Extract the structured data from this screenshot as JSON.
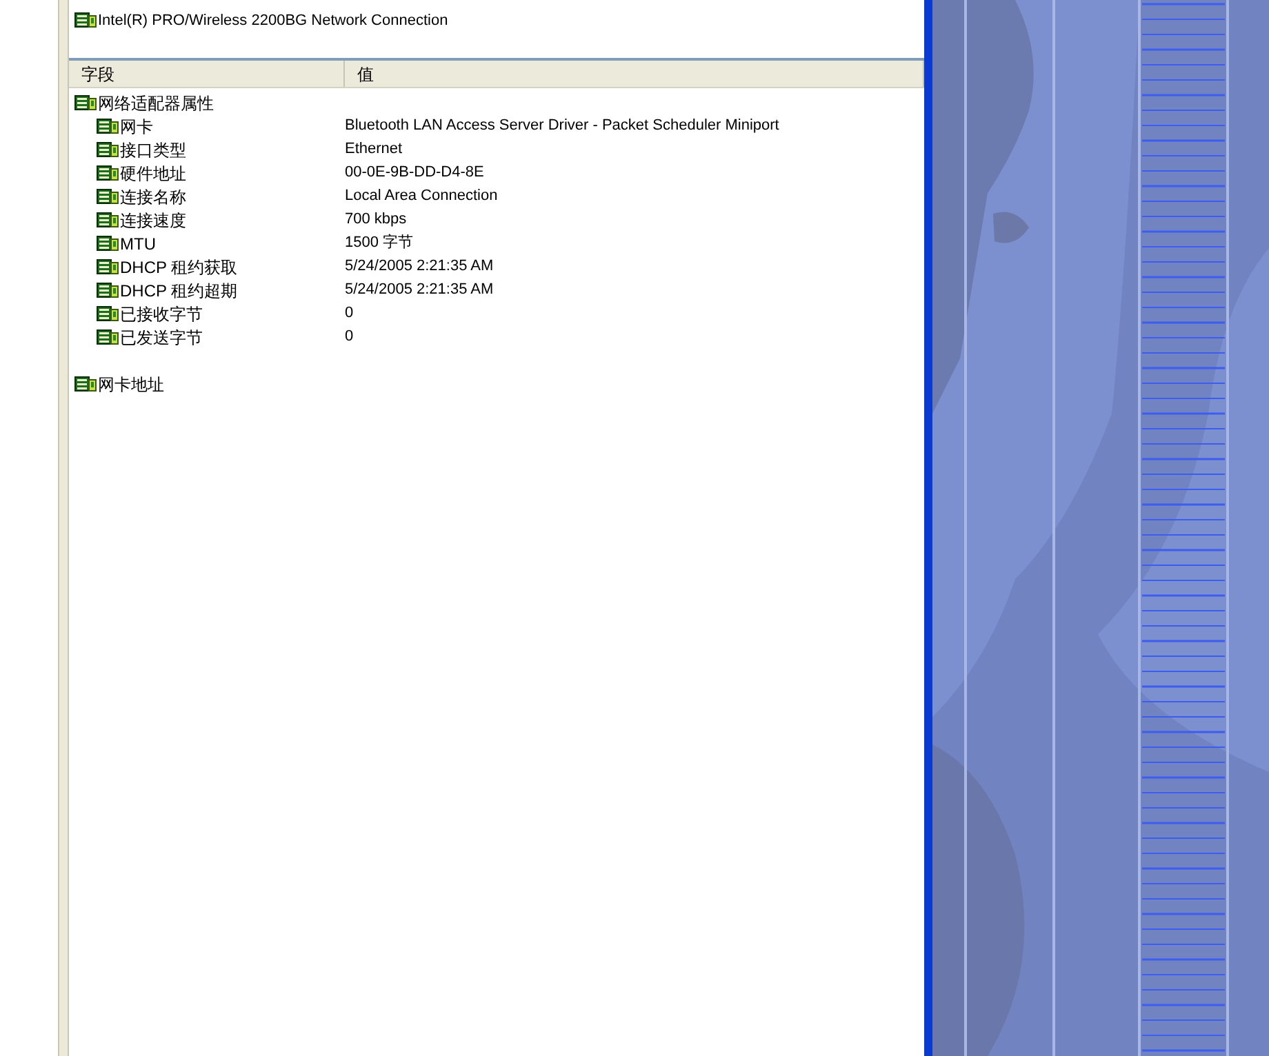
{
  "adapter_list": {
    "items": [
      {
        "label": "Intel(R) PRO/Wireless 2200BG Network Connection"
      }
    ]
  },
  "details": {
    "columns": [
      "字段",
      "值"
    ],
    "tree": [
      {
        "field": "网络适配器属性",
        "children": [
          {
            "field": "网卡",
            "value": "Bluetooth LAN Access Server Driver - Packet Scheduler Miniport"
          },
          {
            "field": "接口类型",
            "value": "Ethernet"
          },
          {
            "field": "硬件地址",
            "value": "00-0E-9B-DD-D4-8E"
          },
          {
            "field": "连接名称",
            "value": "Local Area Connection"
          },
          {
            "field": "连接速度",
            "value": "700 kbps"
          },
          {
            "field": "MTU",
            "value": "1500 字节"
          },
          {
            "field": "DHCP 租约获取",
            "value": "5/24/2005 2:21:35 AM"
          },
          {
            "field": "DHCP 租约超期",
            "value": "5/24/2005 2:21:35 AM"
          },
          {
            "field": "已接收字节",
            "value": "0"
          },
          {
            "field": "已发送字节",
            "value": "0"
          }
        ]
      },
      {
        "field": "网卡地址"
      }
    ]
  }
}
